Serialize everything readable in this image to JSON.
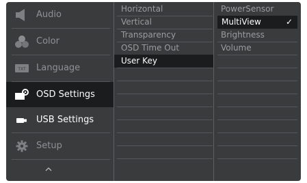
{
  "main_menu": [
    {
      "label": "Audio",
      "icon": "speaker-icon",
      "state": "dim"
    },
    {
      "label": "Color",
      "icon": "color-circles-icon",
      "state": "dim"
    },
    {
      "label": "Language",
      "icon": "language-txt-icon",
      "state": "dim"
    },
    {
      "label": "OSD Settings",
      "icon": "osd-settings-icon",
      "state": "active"
    },
    {
      "label": "USB Settings",
      "icon": "usb-icon",
      "state": "bright"
    },
    {
      "label": "Setup",
      "icon": "gear-icon",
      "state": "dim"
    }
  ],
  "scroll_up_icon": "chevron-up-icon",
  "submenu": {
    "items": [
      "Horizontal",
      "Vertical",
      "Transparency",
      "OSD Time Out",
      "User Key"
    ],
    "selected": "User Key"
  },
  "options": {
    "items": [
      "PowerSensor",
      "MultiView",
      "Brightness",
      "Volume"
    ],
    "selected": "MultiView",
    "checkmark": "✓"
  },
  "colors": {
    "panel": "#3a3b3d",
    "selected_bg": "#1b1c1d",
    "text_dim": "#8f9194",
    "text_active": "#ffffff"
  }
}
